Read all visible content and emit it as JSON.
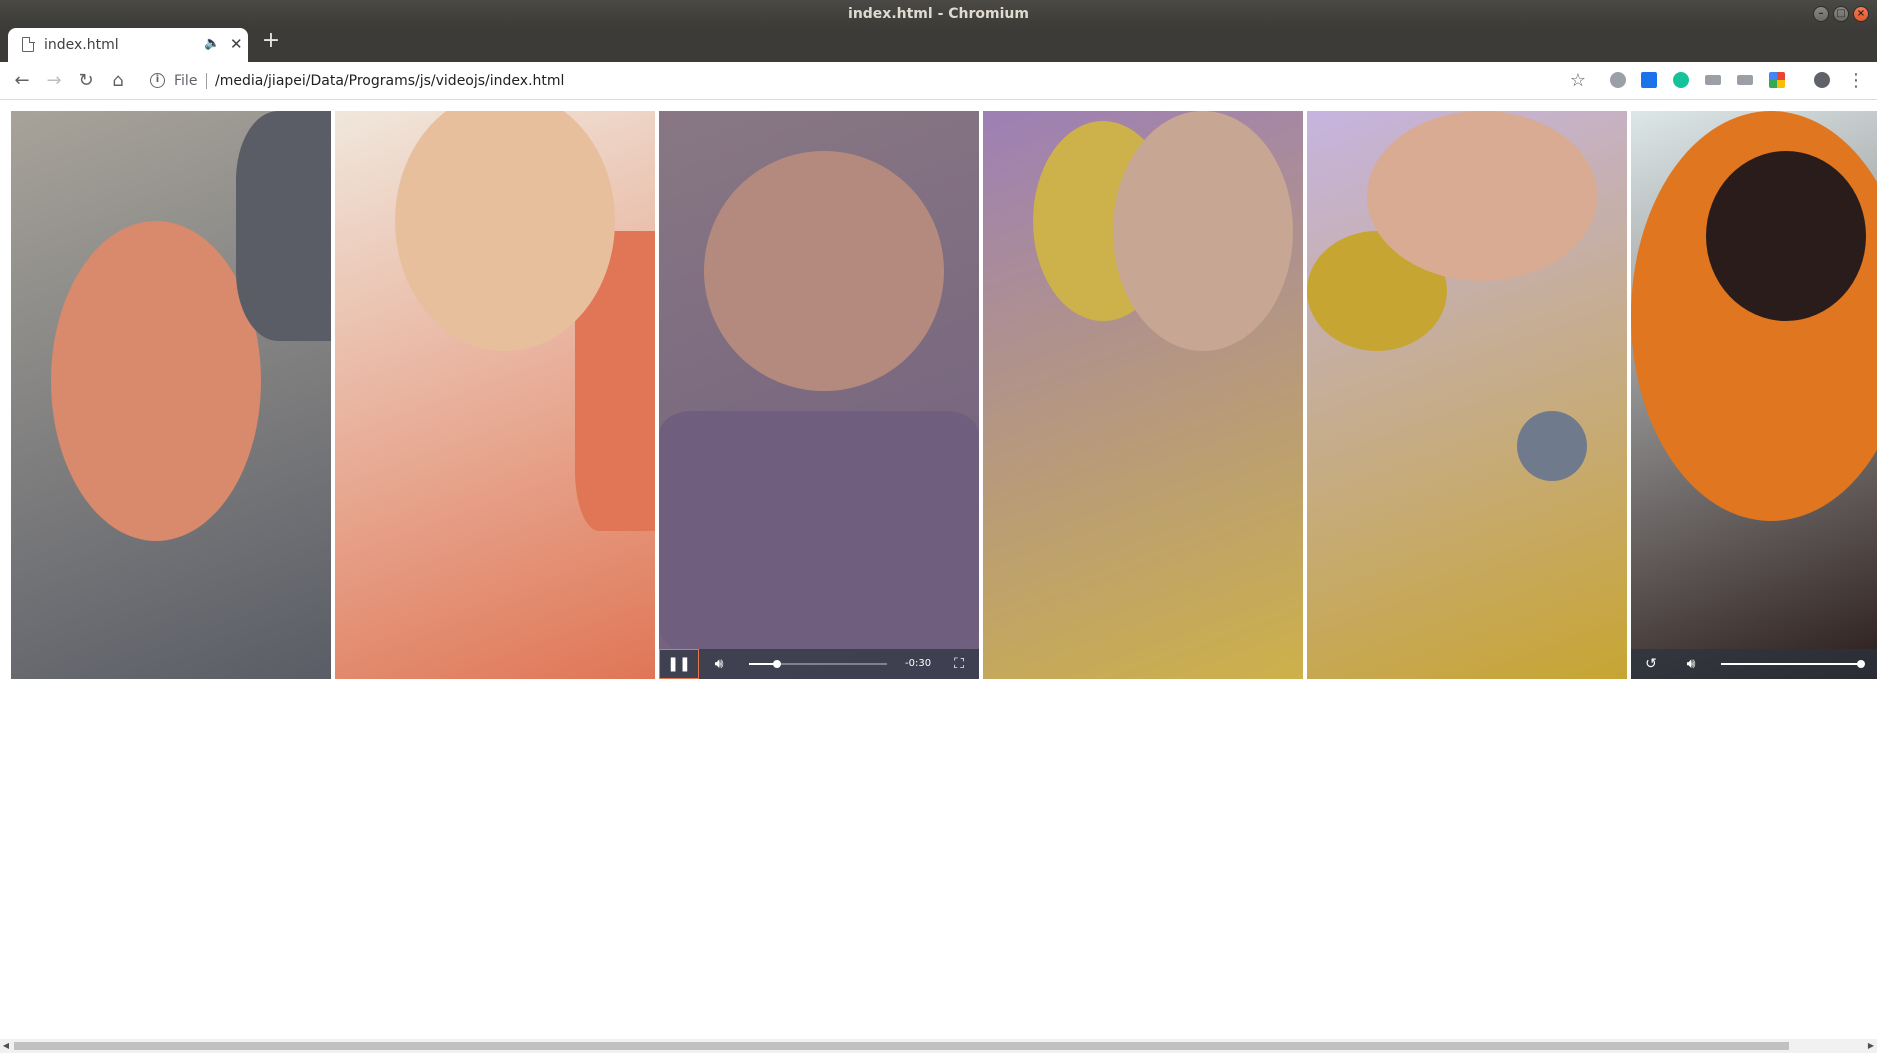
{
  "window": {
    "title": "index.html - Chromium"
  },
  "tab": {
    "title": "index.html"
  },
  "toolbar": {
    "scheme_label": "File",
    "url": "/media/jiapei/Data/Programs/js/videojs/index.html"
  },
  "videos": [
    {
      "id": "video-1",
      "colors": {
        "base": "#a7a39a",
        "subject": "#d9896c",
        "accent": "#5a5d66"
      }
    },
    {
      "id": "video-2",
      "colors": {
        "base": "#f0e7dc",
        "subject": "#e8bf9d",
        "accent": "#e07656"
      }
    },
    {
      "id": "video-3",
      "colors": {
        "base": "#887783",
        "subject": "#b58a7e",
        "accent": "#6f5e7d"
      },
      "player": {
        "state": "playing",
        "remaining_time": "-0:30",
        "progress": 0.2,
        "has_fullscreen": true
      }
    },
    {
      "id": "video-4",
      "colors": {
        "base": "#9e7fb5",
        "subject": "#c7a693",
        "accent": "#cdb14a"
      }
    },
    {
      "id": "video-5",
      "colors": {
        "base": "#c6b4e0",
        "subject": "#d9ab92",
        "accent": "#c7a533"
      }
    },
    {
      "id": "video-6",
      "colors": {
        "base": "#dde7e8",
        "subject": "#e0761f",
        "accent": "#2a1c1a"
      },
      "player": {
        "state": "ended",
        "volume": 1.0
      }
    }
  ]
}
